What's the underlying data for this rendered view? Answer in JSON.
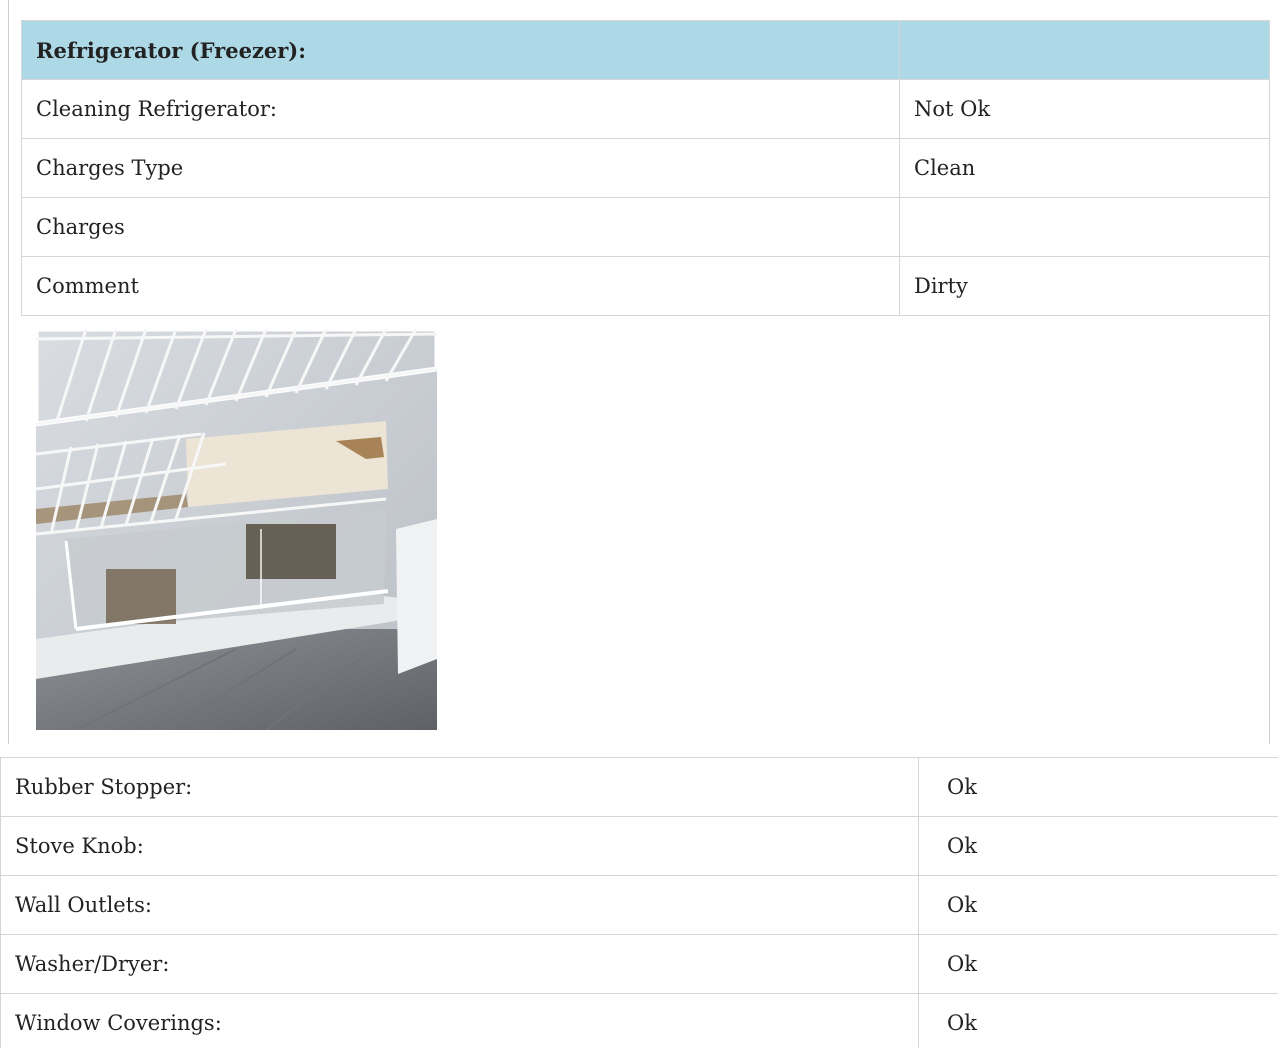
{
  "section": {
    "header": {
      "label": "Refrigerator (Freezer):",
      "value": ""
    },
    "rows": [
      {
        "label": "Cleaning Refrigerator:",
        "value": "Not Ok"
      },
      {
        "label": "Charges Type",
        "value": "Clean"
      },
      {
        "label": "Charges",
        "value": ""
      },
      {
        "label": "Comment",
        "value": "Dirty"
      }
    ],
    "photo_icon": "refrigerator-photo"
  },
  "items": [
    {
      "label": "Rubber Stopper:",
      "value": "Ok"
    },
    {
      "label": "Stove Knob:",
      "value": "Ok"
    },
    {
      "label": "Wall Outlets:",
      "value": "Ok"
    },
    {
      "label": "Washer/Dryer:",
      "value": "Ok"
    },
    {
      "label": "Window Coverings:",
      "value": "Ok"
    }
  ],
  "colors": {
    "header_bg": "#add8e6",
    "border": "#d6d6d6"
  }
}
